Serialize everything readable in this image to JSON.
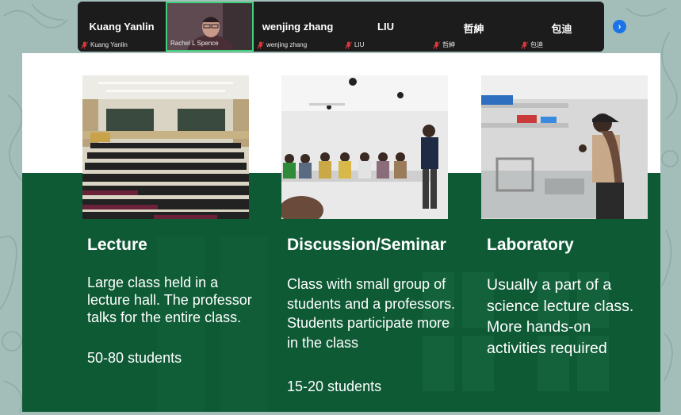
{
  "participants": [
    {
      "display_name": "Kuang Yanlin",
      "label": "Kuang Yanlin",
      "video": false,
      "muted": true
    },
    {
      "display_name": "",
      "label": "Rachel L Spence",
      "video": true,
      "muted": false
    },
    {
      "display_name": "wenjing zhang",
      "label": "wenjing zhang",
      "video": false,
      "muted": true
    },
    {
      "display_name": "LIU",
      "label": "LIU",
      "video": false,
      "muted": true
    },
    {
      "display_name": "哲紳",
      "label": "哲紳",
      "video": false,
      "muted": true
    },
    {
      "display_name": "包迪",
      "label": "包迪",
      "video": false,
      "muted": true
    }
  ],
  "next_button_icon": "chevron-right-icon",
  "slide": {
    "columns": [
      {
        "title": "Lecture",
        "body": "Large class held in a lecture hall. The professor talks for the entire class.",
        "count": "50-80 students"
      },
      {
        "title": "Discussion/Seminar",
        "body": "Class with small group of students and a professors. Students participate more in the class",
        "count": "15-20 students"
      },
      {
        "title": "Laboratory",
        "body": "Usually a part of a science lecture class. More hands-on activities required",
        "count": ""
      }
    ]
  },
  "colors": {
    "slide_green": "#0e5a35",
    "active_speaker_border": "#3fd07a",
    "next_button": "#1a73e8",
    "mic_off": "#e23b3b"
  }
}
